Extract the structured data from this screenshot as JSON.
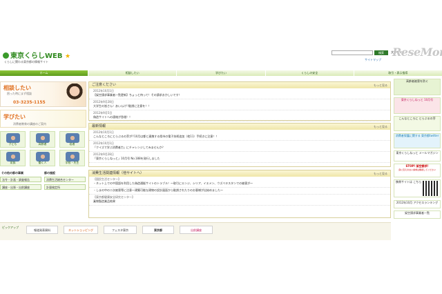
{
  "header": {
    "logo_text": "東京くらしWEB",
    "tagline": "くらしに関わる東京都の情報サイト",
    "font_size_label": "文字サイズ",
    "sitemap_label": "サイトマップ",
    "search_button": "検索"
  },
  "watermark": "ReseMom",
  "nav": [
    "ホーム",
    "相談したい",
    "学びたい",
    "くらしの安全",
    "取引・表示指導"
  ],
  "left": {
    "consult": {
      "title": "相談したい",
      "sub": "困った時にまず相談",
      "tel": "03-3235-1155"
    },
    "learn": {
      "title": "学びたい",
      "sub": "消費者教育の講座のご案内"
    },
    "tiles": [
      "子ども",
      "高齢者",
      "若者",
      "家族",
      "働く人",
      "学校・先生"
    ],
    "projects_heading": "その他の都の事業",
    "other_heading": "都の施設",
    "buttons": [
      "法令・計画・調査報告",
      "消費生活総合センター",
      "講座・出張・出前講座",
      "計量検定所"
    ]
  },
  "notice": {
    "heading": "ご注意ください",
    "more": "もっと見る",
    "items": [
      {
        "date": "2012年10月1日",
        "text": "【架空請求事業者一覧更新】ちょっと待って！その請求おかしいです！"
      },
      {
        "date": "2012年9月28日",
        "text": "大学生の皆さん！あいんけ!!勧誘に注意を！！"
      },
      {
        "date": "2012年9月5日",
        "text": "偽造サイトへの連絡が急増！！"
      }
    ]
  },
  "news": {
    "heading": "最新情報",
    "more": "もっと見る",
    "items": [
      {
        "date": "2012年10月1日",
        "text": "こんなところにとらぶるの芽が!!10月は都と連携する県市の電子技術追加（他11）手続きに注意！！"
      },
      {
        "date": "2012年10月1日",
        "text": "「クイズで学ぶ消費者力」にチャレンジしてみませんか？"
      },
      {
        "date": "2012年9月28日",
        "text": "「東京くらしねっと」10月号 No.188を発行しました"
      }
    ]
  },
  "related": {
    "heading": "消費生活関連情報（他サイトへ）",
    "more": "もっと見る",
    "items": [
      {
        "date": "【国民生活センター】",
        "text": "・ネット上での中国語を利用した偽造通販サイトのトラブル！～取引にエンジ、シリア、イエメン、ウズベキスタンでの被害が～"
      },
      {
        "date": "",
        "text": "・しまの中の二次被害等に注意～建築可能な建物の設計図面から勧誘されたりのお客様が出始めました～"
      },
      {
        "date": "【東京都健康安全研究センター】",
        "text": "乗物製造業品結果"
      }
    ]
  },
  "right": {
    "items": [
      "高齢者被害を防ぐ",
      "東京くらしねっと 10月号",
      "こんなところに とらぶるの芽",
      "消費者保護に関する 東京都twitter",
      "東京くらしねっと メールマガジン",
      "STOP! 架空請求!",
      "携帯サイトは こちら",
      "2012年10月 アクセスランキング",
      "架空請求事業者一覧"
    ],
    "stop_sub": "身に覚えのない請求は無視してください"
  },
  "pickup": {
    "label": "ピックアップ",
    "items": [
      "報道発表資料",
      "ネットショッピング",
      "フェスタ東京",
      "東京都",
      "出前講座"
    ]
  }
}
